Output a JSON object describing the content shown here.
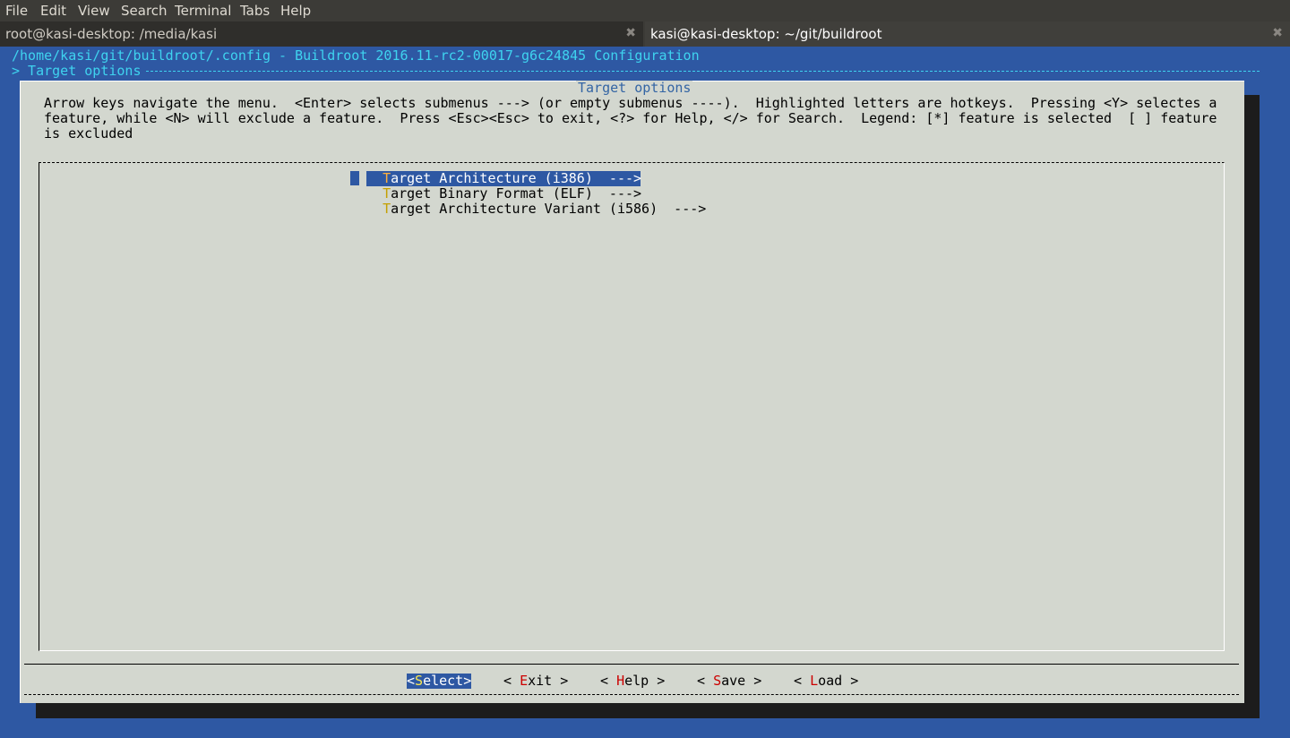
{
  "menu": [
    "File",
    "Edit",
    "View",
    "Search",
    "Terminal",
    "Tabs",
    "Help"
  ],
  "tabs": [
    {
      "title": "root@kasi-desktop: /media/kasi",
      "close": "✖"
    },
    {
      "title": "kasi@kasi-desktop: ~/git/buildroot",
      "close": "✖"
    }
  ],
  "terminal": {
    "path_line": "/home/kasi/git/buildroot/.config - Buildroot 2016.11-rc2-00017-g6c24845 Configuration",
    "breadcrumb": "> Target options",
    "dialog_title": "Target options",
    "help_lines": [
      "Arrow keys navigate the menu.  <Enter> selects submenus ---> (or empty submenus ----).  Highlighted letters are hotkeys.  Pressing <Y> selectes a",
      "feature, while <N> will exclude a feature.  Press <Esc><Esc> to exit, <?> for Help, </> for Search.  Legend: [*] feature is selected  [ ] feature",
      "is excluded"
    ],
    "items": [
      {
        "hot": "T",
        "rest": "arget Architecture (i386)  --->"
      },
      {
        "hot": "T",
        "rest": "arget Binary Format (ELF)  --->"
      },
      {
        "hot": "T",
        "rest": "arget Architecture Variant (i586)  --->"
      }
    ],
    "buttons": [
      {
        "pre": "<",
        "hot": "S",
        "rest": "elect>"
      },
      {
        "pre": "< ",
        "hot": "E",
        "rest": "xit >"
      },
      {
        "pre": "< ",
        "hot": "H",
        "rest": "elp >"
      },
      {
        "pre": "< ",
        "hot": "S",
        "rest": "ave >"
      },
      {
        "pre": "< ",
        "hot": "L",
        "rest": "oad >"
      }
    ]
  },
  "colors": {
    "terminal_bg": "#2e58a3",
    "dialog_bg": "#d3d7cf",
    "title_cyan": "#3fd3ef",
    "hotkey_red": "#cc0000"
  }
}
